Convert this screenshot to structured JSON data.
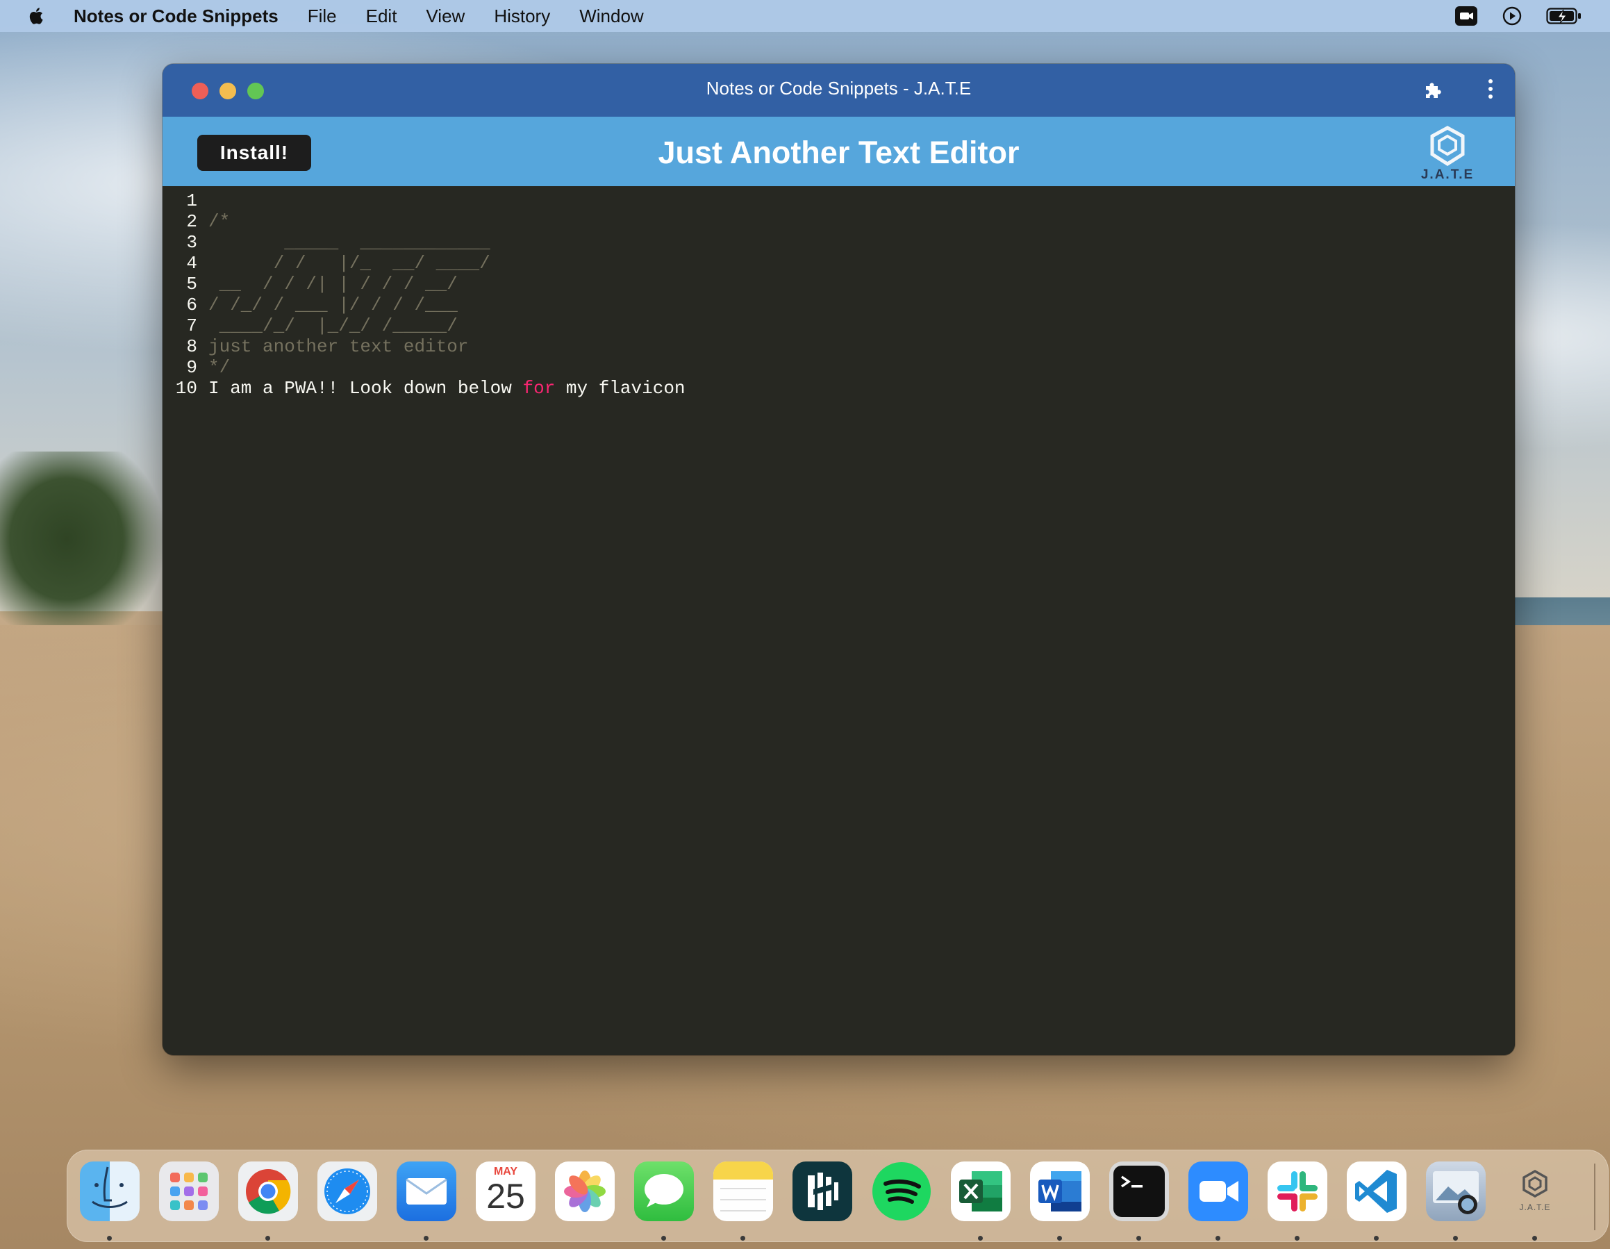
{
  "menubar": {
    "app_name": "Notes or Code Snippets",
    "items": [
      "File",
      "Edit",
      "View",
      "History",
      "Window"
    ],
    "status_icons": [
      "camera-icon",
      "play-circle-icon",
      "battery-charging-icon"
    ]
  },
  "window": {
    "title": "Notes or Code Snippets - J.A.T.E",
    "header": {
      "install_label": "Install!",
      "title": "Just Another Text Editor",
      "logo_text": "J.A.T.E"
    }
  },
  "editor": {
    "lines": [
      {
        "n": "1",
        "text": "",
        "kind": "txt"
      },
      {
        "n": "2",
        "text": "/*",
        "kind": "cmt"
      },
      {
        "n": "3",
        "text": "       _____  ____________",
        "kind": "cmt"
      },
      {
        "n": "4",
        "text": "      / /   |/_  __/ ____/",
        "kind": "cmt"
      },
      {
        "n": "5",
        "text": " __  / / /| | / / / __/",
        "kind": "cmt"
      },
      {
        "n": "6",
        "text": "/ /_/ / ___ |/ / / /___",
        "kind": "cmt"
      },
      {
        "n": "7",
        "text": " ____/_/  |_/_/ /_____/",
        "kind": "cmt"
      },
      {
        "n": "8",
        "text": "just another text editor",
        "kind": "cmt"
      },
      {
        "n": "9",
        "text": "*/",
        "kind": "cmt"
      },
      {
        "n": "10",
        "before": "I am a PWA!! Look down below ",
        "keyword": "for",
        "after": " my flavicon",
        "kind": "mixed"
      }
    ]
  },
  "dock": {
    "apps": [
      {
        "name": "finder",
        "running": true
      },
      {
        "name": "launchpad",
        "running": false
      },
      {
        "name": "chrome",
        "running": true
      },
      {
        "name": "safari",
        "running": false
      },
      {
        "name": "mail",
        "running": true
      },
      {
        "name": "calendar",
        "running": false,
        "month": "MAY",
        "day": "25"
      },
      {
        "name": "photos",
        "running": false
      },
      {
        "name": "messages",
        "running": true
      },
      {
        "name": "notes",
        "running": true
      },
      {
        "name": "dashlane",
        "running": false
      },
      {
        "name": "spotify",
        "running": false
      },
      {
        "name": "excel",
        "running": true
      },
      {
        "name": "word",
        "running": true
      },
      {
        "name": "terminal",
        "running": true
      },
      {
        "name": "zoom",
        "running": true
      },
      {
        "name": "slack",
        "running": true
      },
      {
        "name": "vscode",
        "running": true
      },
      {
        "name": "preview",
        "running": true
      },
      {
        "name": "jate",
        "running": true,
        "label": "J.A.T.E"
      }
    ]
  },
  "colors": {
    "titlebar": "#3260a4",
    "header": "#56a6dc",
    "editor_bg": "#272822",
    "comment": "#75715e",
    "keyword": "#f92672"
  }
}
